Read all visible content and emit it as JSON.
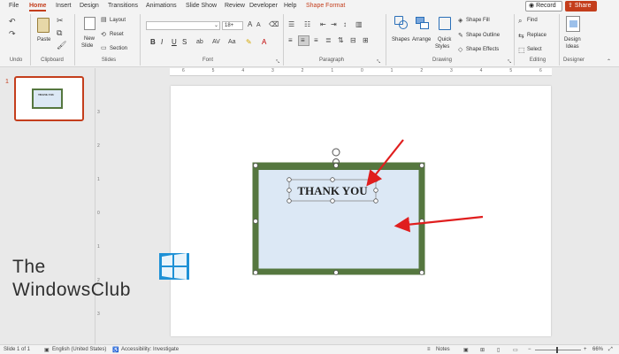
{
  "menu": {
    "tabs": [
      "File",
      "Home",
      "Insert",
      "Design",
      "Transitions",
      "Animations",
      "Slide Show",
      "Review",
      "Developer",
      "Help",
      "Shape Format"
    ],
    "active_tab": "Home",
    "record_label": "Record",
    "share_label": "Share"
  },
  "ribbon": {
    "groups": {
      "undo": "Undo",
      "clipboard": "Clipboard",
      "slides": "Slides",
      "font": "Font",
      "paragraph": "Paragraph",
      "drawing": "Drawing",
      "editing": "Editing",
      "designer": "Designer"
    },
    "clipboard": {
      "paste": "Paste"
    },
    "slides": {
      "new_slide": "New",
      "new_slide2": "Slide",
      "layout": "Layout",
      "reset": "Reset",
      "section": "Section"
    },
    "font": {
      "size": "18+",
      "bold": "B",
      "italic": "I",
      "underline": "U",
      "strike": "S"
    },
    "drawing": {
      "shapes": "Shapes",
      "arrange": "Arrange",
      "quick_styles": "Quick",
      "quick_styles2": "Styles",
      "fill": "Shape Fill",
      "outline": "Shape Outline",
      "effects": "Shape Effects"
    },
    "editing": {
      "find": "Find",
      "replace": "Replace",
      "select": "Select"
    },
    "designer": {
      "ideas": "Design",
      "ideas2": "Ideas"
    }
  },
  "ruler": {
    "h": [
      "6",
      "5",
      "4",
      "3",
      "2",
      "1",
      "0",
      "1",
      "2",
      "3",
      "4",
      "5",
      "6"
    ],
    "v": [
      "3",
      "2",
      "1",
      "0",
      "1",
      "2",
      "3"
    ]
  },
  "thumbnail": {
    "number": "1",
    "text": "THANK YOU"
  },
  "slide": {
    "textbox_text": "THANK YOU"
  },
  "status": {
    "slide_info": "Slide 1 of 1",
    "language": "English (United States)",
    "accessibility": "Accessibility: Investigate",
    "notes": "Notes",
    "zoom": "66%"
  },
  "watermark": {
    "line1": "The",
    "line2": "WindowsClub"
  },
  "colors": {
    "accent": "#c43e1c",
    "shape_fill": "#dce8f5",
    "shape_border": "#55773f",
    "arrow": "#e01e1e"
  }
}
